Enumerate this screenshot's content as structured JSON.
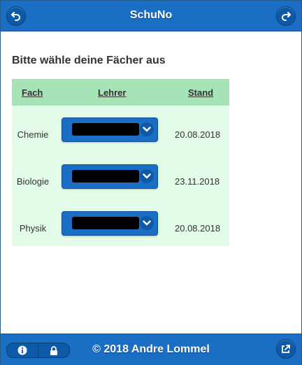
{
  "header": {
    "title": "SchuNo",
    "left_icon": "back-icon",
    "right_icon": "forward-icon"
  },
  "content": {
    "heading": "Bitte wähle deine Fächer aus"
  },
  "table": {
    "columns": [
      "Fach",
      "Lehrer",
      "Stand"
    ],
    "rows": [
      {
        "fach": "Chemie",
        "lehrer": "",
        "stand": "20.08.2018"
      },
      {
        "fach": "Biologie",
        "lehrer": "",
        "stand": "23.11.2018"
      },
      {
        "fach": "Physik",
        "lehrer": "",
        "stand": "20.08.2018"
      }
    ]
  },
  "footer": {
    "text": "© 2018 Andre Lommel",
    "info_icon": "info-icon",
    "lock_icon": "lock-icon",
    "share_icon": "share-icon"
  },
  "colors": {
    "primary": "#1a6fc4",
    "table_header": "#a6e3b6",
    "table_body": "#e3fbe9"
  }
}
